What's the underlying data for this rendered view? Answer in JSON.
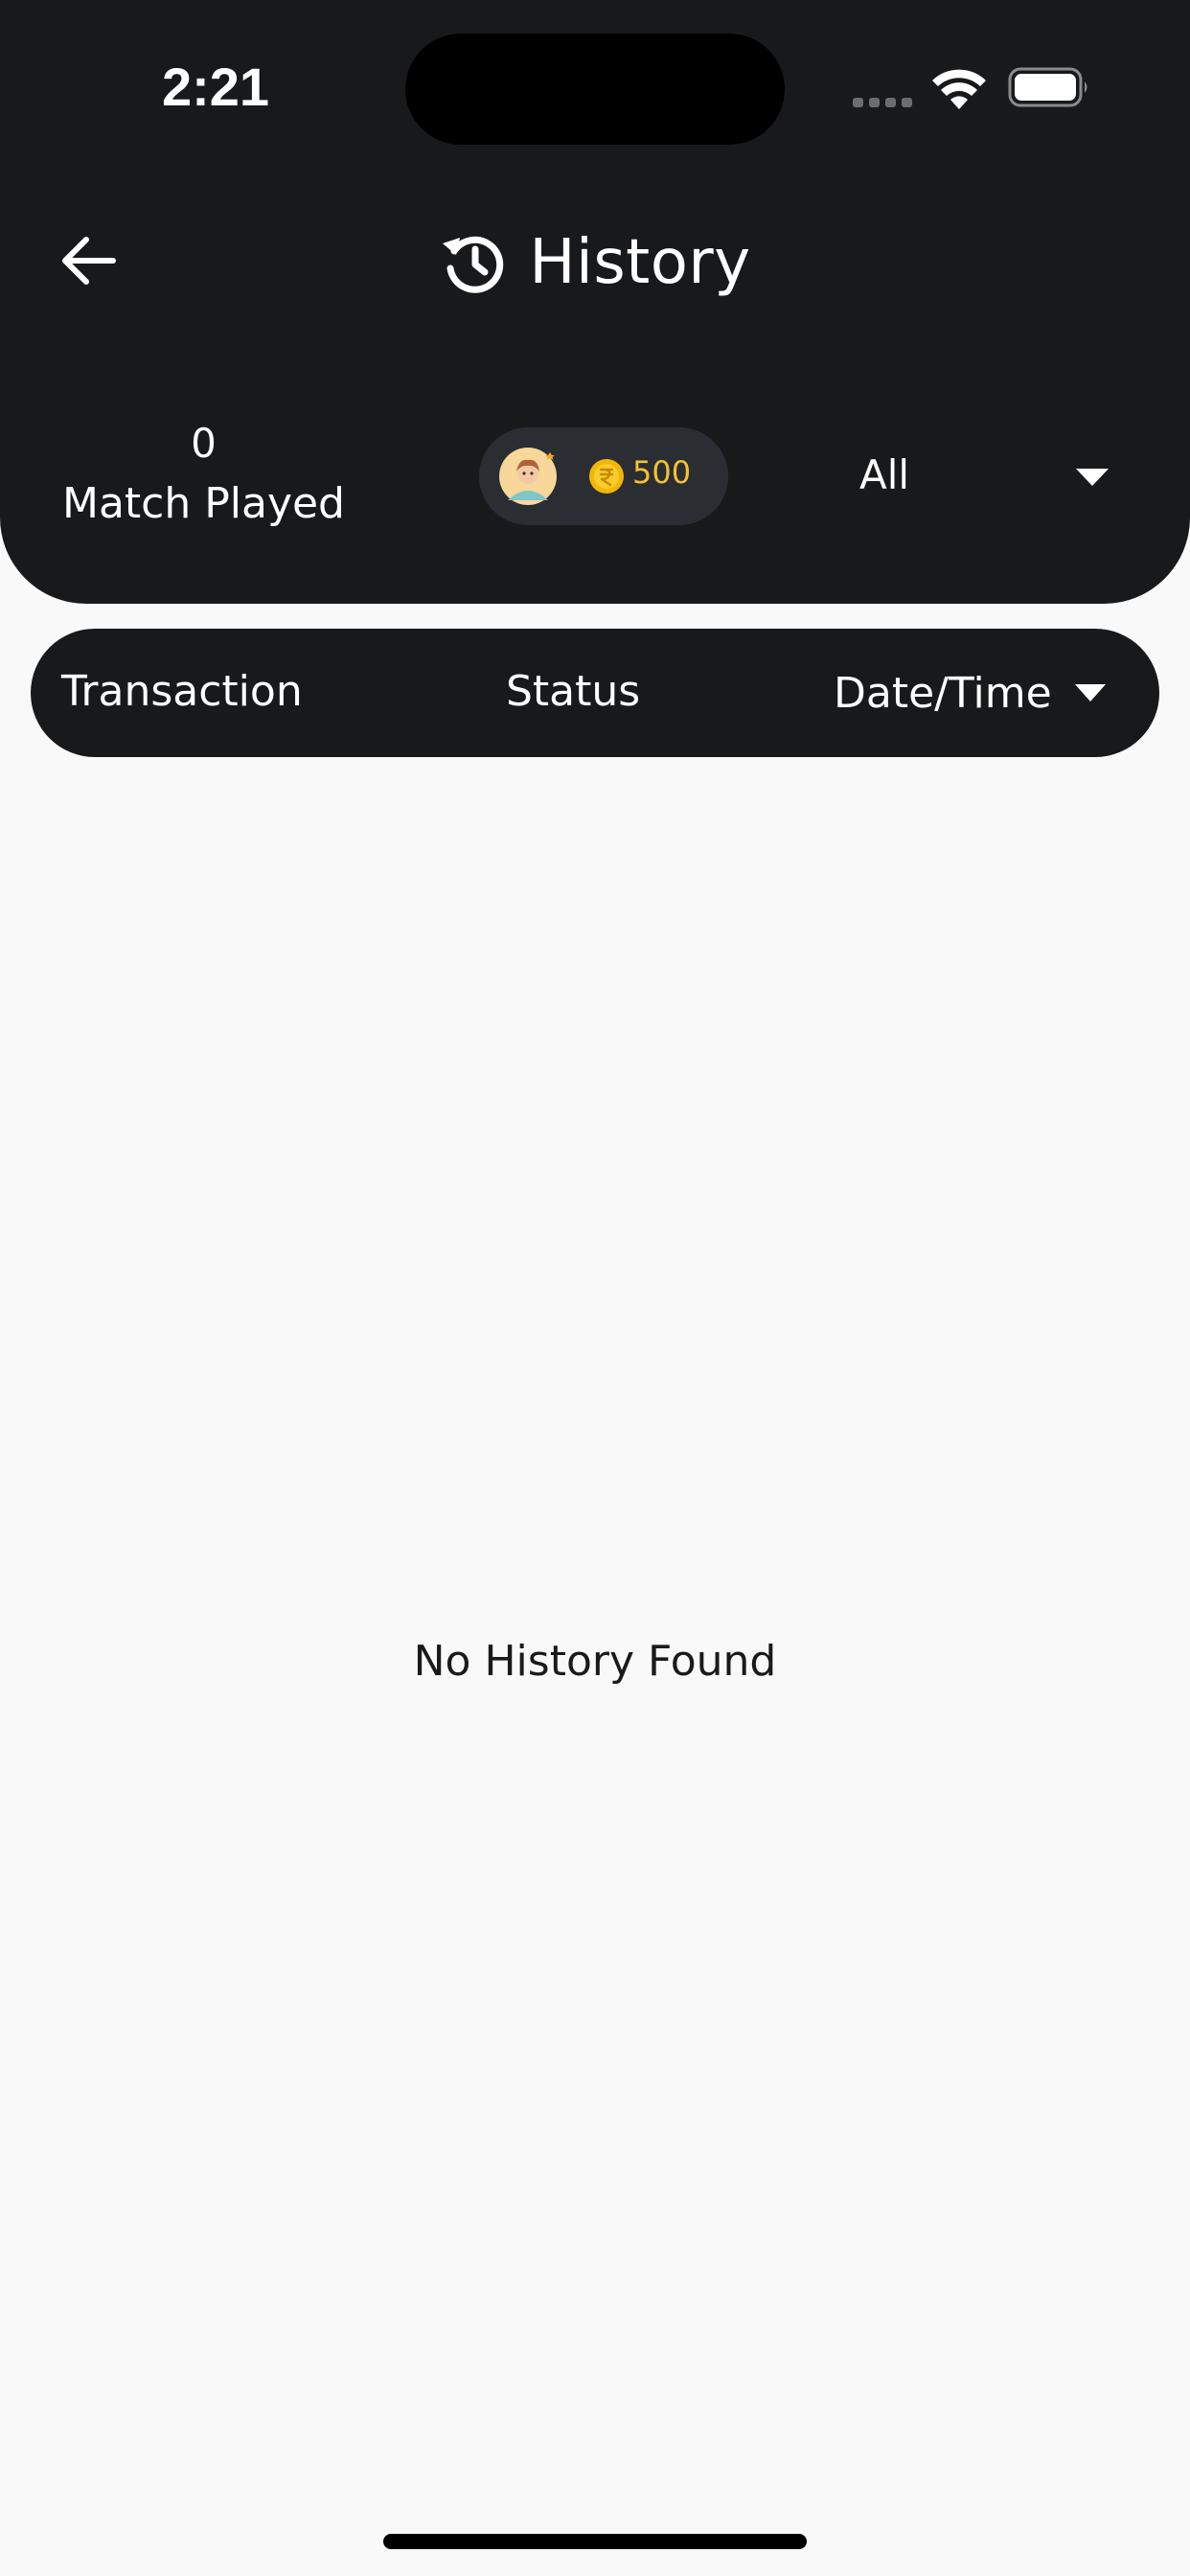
{
  "status_bar": {
    "time": "2:21"
  },
  "nav": {
    "title": "History",
    "back_icon": "arrow-left-icon",
    "title_icon": "history-icon"
  },
  "stats": {
    "match_count": "0",
    "match_label": "Match Played",
    "coin_balance": "500",
    "filter_value": "All"
  },
  "table": {
    "columns": [
      "Transaction",
      "Status",
      "Date/Time"
    ]
  },
  "empty_state": {
    "message": "No History Found"
  },
  "colors": {
    "header_bg": "#18191b",
    "page_bg": "#f9f9f9",
    "coin_pill_bg": "#2a2d31",
    "coin_text": "#f2c232"
  }
}
